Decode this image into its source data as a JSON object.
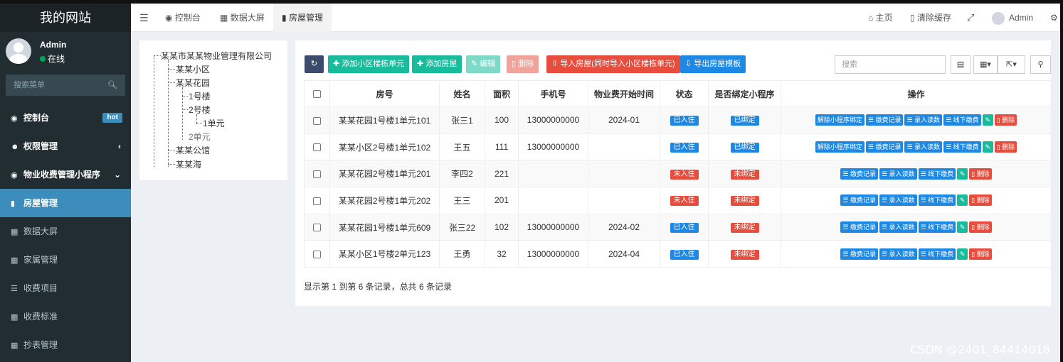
{
  "sidebar": {
    "logo": "我的网站",
    "user": {
      "name": "Admin",
      "status": "在线"
    },
    "search_placeholder": "搜索菜单",
    "items": [
      {
        "label": "控制台",
        "icon": "dashboard-icon",
        "badge": "hot"
      },
      {
        "label": "权限管理",
        "icon": "users-icon"
      },
      {
        "label": "物业收费管理小程序",
        "icon": "dashboard-icon"
      },
      {
        "label": "房屋管理",
        "icon": "book-icon"
      },
      {
        "label": "数据大屏",
        "icon": "table-icon"
      },
      {
        "label": "家属管理",
        "icon": "table-icon"
      },
      {
        "label": "收费项目",
        "icon": "list-icon"
      },
      {
        "label": "收费标准",
        "icon": "table-icon"
      },
      {
        "label": "抄表管理",
        "icon": "table-icon"
      }
    ]
  },
  "topbar": {
    "tabs": [
      {
        "label": "控制台",
        "icon": "dashboard-icon"
      },
      {
        "label": "数据大屏",
        "icon": "table-icon"
      },
      {
        "label": "房屋管理",
        "icon": "book-icon"
      }
    ],
    "home": "主页",
    "clear_cache": "清除缓存",
    "admin": "Admin"
  },
  "tree": {
    "root": "某某市某某物业管理有限公司",
    "nodes": [
      "某某小区",
      "某某花园",
      "1号楼",
      "2号楼",
      "1单元",
      "2单元",
      "某某公馆",
      "某某海"
    ]
  },
  "toolbar": {
    "add_unit": "添加小区楼栋单元",
    "add_house": "添加房屋",
    "edit": "编辑",
    "delete": "删除",
    "import": "导入房屋(同时导入小区楼栋单元)",
    "export_template": "导出房屋模板",
    "search_placeholder": "搜索"
  },
  "table": {
    "headers": [
      "房号",
      "姓名",
      "面积",
      "手机号",
      "物业费开始时间",
      "状态",
      "是否绑定小程序",
      "操作"
    ],
    "rows": [
      {
        "room": "某某花园1号楼1单元101",
        "name": "张三1",
        "area": "100",
        "phone": "13000000000",
        "start": "2024-01",
        "status": "已入住",
        "bound": "已绑定"
      },
      {
        "room": "某某小区2号楼1单元102",
        "name": "王五",
        "area": "111",
        "phone": "13000000000",
        "start": "",
        "status": "已入住",
        "bound": "已绑定"
      },
      {
        "room": "某某花园2号楼1单元201",
        "name": "李四2",
        "area": "221",
        "phone": "",
        "start": "",
        "status": "未入住",
        "bound": "未绑定"
      },
      {
        "room": "某某花园2号楼1单元202",
        "name": "王三",
        "area": "201",
        "phone": "",
        "start": "",
        "status": "未入住",
        "bound": "未绑定"
      },
      {
        "room": "某某花园1号楼1单元609",
        "name": "张三22",
        "area": "102",
        "phone": "13000000000",
        "start": "2024-02",
        "status": "已入住",
        "bound": "未绑定"
      },
      {
        "room": "某某小区1号楼2单元123",
        "name": "王勇",
        "area": "32",
        "phone": "13000000000",
        "start": "2024-04",
        "status": "已入住",
        "bound": "未绑定"
      }
    ],
    "actions": {
      "unbind": "解除小程序绑定",
      "fee_record": "缴费记录",
      "enter_reading": "录入读数",
      "offline_pay": "线下缴费",
      "delete": "删除"
    },
    "footer": "显示第 1 到第 6 条记录，总共 6 条记录"
  },
  "watermark": "CSDN @2401_84414018",
  "colors": {
    "accent": "#3c8dbc",
    "sidebar": "#222d32",
    "green": "#18bc9c",
    "red": "#e74c3c",
    "blue": "#1e88e5"
  }
}
